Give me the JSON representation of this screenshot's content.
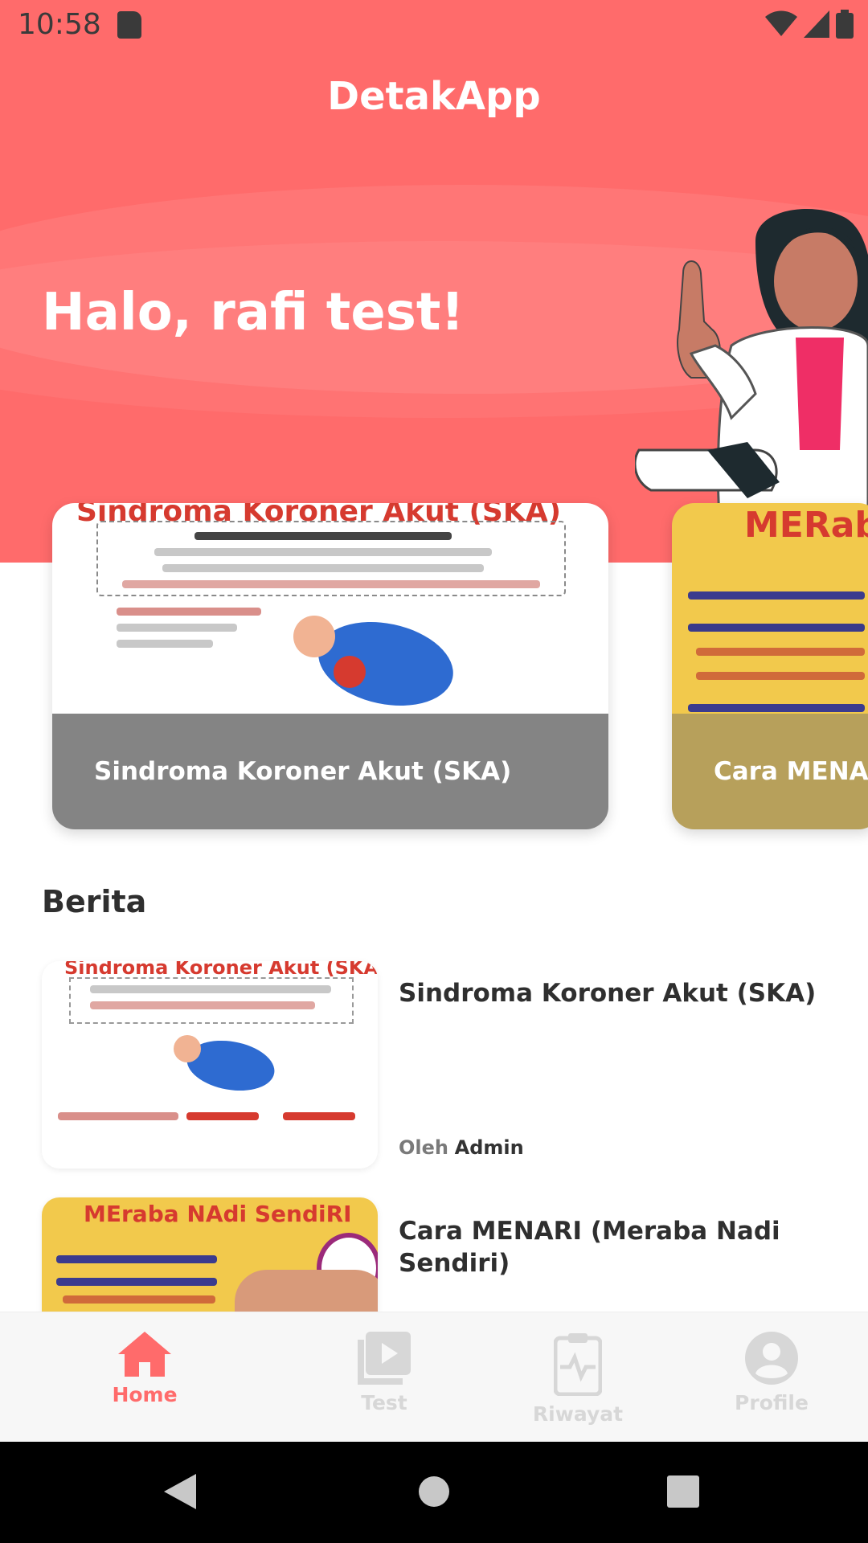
{
  "status_bar": {
    "time": "10:58"
  },
  "header": {
    "app_title": "DetakApp",
    "greeting": "Halo, rafi test!"
  },
  "carousel": {
    "items": [
      {
        "caption": "Sindroma Koroner Akut (SKA)",
        "image_heading": "Sindroma Koroner Akut (SKA)"
      },
      {
        "caption": "Cara MENAR",
        "image_heading": "MERab"
      }
    ]
  },
  "news": {
    "section_title": "Berita",
    "items": [
      {
        "title": "Sindroma Koroner Akut (SKA)",
        "author_prefix": "Oleh",
        "author": "Admin",
        "thumb_heading": "Sindroma Koroner Akut (SKA)"
      },
      {
        "title": "Cara MENARI (Meraba Nadi Sendiri)",
        "thumb_heading": "MEraba NAdi SendiRI"
      }
    ]
  },
  "bottom_nav": {
    "items": [
      {
        "label": "Home",
        "icon": "home-icon",
        "active": true
      },
      {
        "label": "Test",
        "icon": "play-icon",
        "active": false
      },
      {
        "label": "Riwayat",
        "icon": "clipboard-icon",
        "active": false
      },
      {
        "label": "Profile",
        "icon": "profile-icon",
        "active": false
      }
    ]
  },
  "colors": {
    "primary": "#ff6b6b",
    "inactive": "#d7d7d7"
  }
}
